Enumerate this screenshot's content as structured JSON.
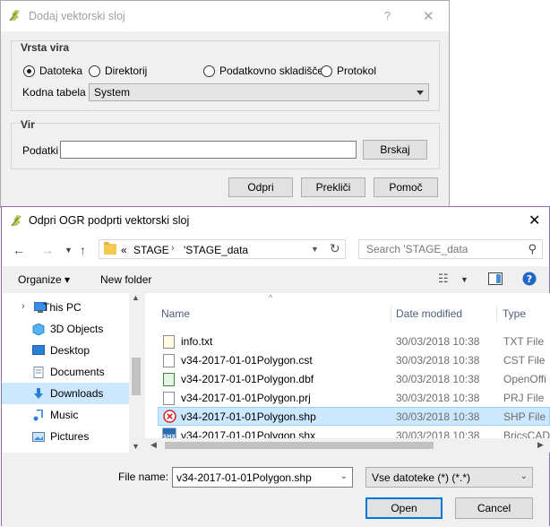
{
  "qgis_dialog": {
    "title": "Dodaj vektorski sloj",
    "help_label": "?",
    "close_label": "✕",
    "source_type": {
      "title": "Vrsta vira",
      "options": [
        {
          "label": "Datoteka",
          "selected": true
        },
        {
          "label": "Direktorij",
          "selected": false
        },
        {
          "label": "Podatkovno skladišče",
          "selected": false
        },
        {
          "label": "Protokol",
          "selected": false
        }
      ],
      "encoding_label": "Kodna tabela",
      "encoding_value": "System"
    },
    "source": {
      "title": "Vir",
      "dataset_label": "Podatki",
      "dataset_value": "",
      "browse_label": "Brskaj"
    },
    "buttons": {
      "open": "Odpri",
      "cancel": "Prekliči",
      "help": "Pomoč"
    }
  },
  "file_dialog": {
    "title": "Odpri OGR podprti vektorski sloj",
    "close_label": "✕",
    "address": {
      "overflow": "«",
      "crumbs": [
        "STAGE",
        "'STAGE_data"
      ]
    },
    "search_placeholder": "Search 'STAGE_data",
    "toolbar": {
      "organize": "Organize ▾",
      "new_folder": "New folder"
    },
    "nav_items": [
      {
        "label": "This PC",
        "icon": "pc-icon",
        "selected": false
      },
      {
        "label": "3D Objects",
        "icon": "cube-icon",
        "selected": false
      },
      {
        "label": "Desktop",
        "icon": "desktop-icon",
        "selected": false
      },
      {
        "label": "Documents",
        "icon": "documents-icon",
        "selected": false
      },
      {
        "label": "Downloads",
        "icon": "download-icon",
        "selected": true
      },
      {
        "label": "Music",
        "icon": "music-icon",
        "selected": false
      },
      {
        "label": "Pictures",
        "icon": "pictures-icon",
        "selected": false
      }
    ],
    "columns": {
      "name": "Name",
      "date": "Date modified",
      "type": "Type"
    },
    "files": [
      {
        "name": "info.txt",
        "date": "30/03/2018 10:38",
        "type": "TXT File",
        "icon": "text-file-icon",
        "selected": false
      },
      {
        "name": "v34-2017-01-01Polygon.cst",
        "date": "30/03/2018 10:38",
        "type": "CST File",
        "icon": "file-icon",
        "selected": false
      },
      {
        "name": "v34-2017-01-01Polygon.dbf",
        "date": "30/03/2018 10:38",
        "type": "OpenOffi",
        "icon": "spreadsheet-icon",
        "selected": false
      },
      {
        "name": "v34-2017-01-01Polygon.prj",
        "date": "30/03/2018 10:38",
        "type": "PRJ File",
        "icon": "file-icon",
        "selected": false
      },
      {
        "name": "v34-2017-01-01Polygon.shp",
        "date": "30/03/2018 10:38",
        "type": "SHP File",
        "icon": "shp-error-icon",
        "selected": true
      },
      {
        "name": "v34-2017-01-01Polygon.shx",
        "date": "30/03/2018 10:38",
        "type": "BricsCAD",
        "icon": "shx-icon",
        "selected": false
      }
    ],
    "filename_label": "File name:",
    "filename_value": "v34-2017-01-01Polygon.shp",
    "filetype_value": "Vse datoteke (*) (*.*)",
    "buttons": {
      "open": "Open",
      "cancel": "Cancel"
    }
  }
}
